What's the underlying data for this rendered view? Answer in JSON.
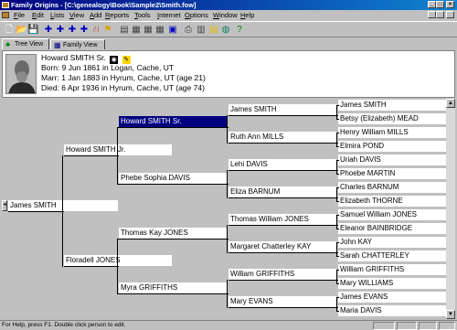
{
  "window": {
    "title": "Family Origins - [C:\\genealogy\\Book\\Sample2\\Smith.fow]",
    "controls": [
      "_",
      "□",
      "×"
    ]
  },
  "menu": [
    "File",
    "Edit",
    "Lists",
    "View",
    "Add",
    "Reports",
    "Tools",
    "Internet",
    "Options",
    "Window",
    "Help"
  ],
  "toolbar": [
    {
      "icon": "new-file-icon",
      "glyph": "🗋"
    },
    {
      "icon": "open-folder-icon",
      "glyph": "📂"
    },
    {
      "icon": "save-icon",
      "glyph": "💾"
    },
    {
      "icon": "add-person-icon",
      "glyph": "✚"
    },
    {
      "icon": "add-parents-icon",
      "glyph": "✚"
    },
    {
      "icon": "add-spouse-icon",
      "glyph": "✚"
    },
    {
      "icon": "add-child-icon",
      "glyph": "✚"
    },
    {
      "icon": "merge-icon",
      "glyph": "⛙"
    },
    {
      "icon": "flag-icon",
      "glyph": "⚑"
    },
    {
      "icon": "report-icon",
      "glyph": "▤"
    },
    {
      "icon": "pedigree-chart-icon",
      "glyph": "▦"
    },
    {
      "icon": "family-group-icon",
      "glyph": "▦"
    },
    {
      "icon": "descendant-chart-icon",
      "glyph": "▦"
    },
    {
      "icon": "book-icon",
      "glyph": "▣"
    },
    {
      "icon": "print-icon",
      "glyph": "⎙"
    },
    {
      "icon": "calculator-icon",
      "glyph": "▥"
    },
    {
      "icon": "notes-icon",
      "glyph": "▤"
    },
    {
      "icon": "web-globe-icon",
      "glyph": "◍"
    },
    {
      "icon": "help-icon",
      "glyph": "?"
    }
  ],
  "tabs": [
    {
      "label": "Tree View",
      "icon": "tree-view-icon",
      "active": true
    },
    {
      "label": "Family View",
      "icon": "family-view-icon",
      "active": false
    }
  ],
  "info": {
    "name": "Howard SMITH Sr.",
    "born": "Born: 9 Jun 1861 in Logan, Cache, UT",
    "marr": "Marr: 1 Jan 1883 in Hyrum, Cache, UT (age 21)",
    "died": "Died: 6 Apr 1936 in Hyrum, Cache, UT (age 74)"
  },
  "tree": {
    "gen1": [
      "James SMITH"
    ],
    "gen2": [
      "Howard SMITH Jr.",
      "Floradell JONES"
    ],
    "gen3": [
      "Howard SMITH Sr.",
      "Phebe Sophia DAVIS",
      "Thomas Kay JONES",
      "Myra GRIFFITHS"
    ],
    "gen4": [
      "James SMITH",
      "Ruth Ann MILLS",
      "Lehi DAVIS",
      "Eliza BARNUM",
      "Thomas William JONES",
      "Margaret Chatterley KAY",
      "William GRIFFITHS",
      "Mary EVANS"
    ],
    "gen5": [
      "James SMITH",
      "Betsy (Elizabeth) MEAD",
      "Henry William MILLS",
      "Elmira POND",
      "Uriah DAVIS",
      "Phoebe MARTIN",
      "Charles BARNUM",
      "Elizabeth THORNE",
      "Samuel William JONES",
      "Eleanor BAINBRIDGE",
      "John KAY",
      "Sarah CHATTERLEY",
      "William GRIFFITHS",
      "Mary WILLIAMS",
      "James EVANS",
      "Maria DAVIS"
    ],
    "selected": "Howard SMITH Sr."
  },
  "status": {
    "text": "For Help, press F1.  Double click person to edit."
  }
}
